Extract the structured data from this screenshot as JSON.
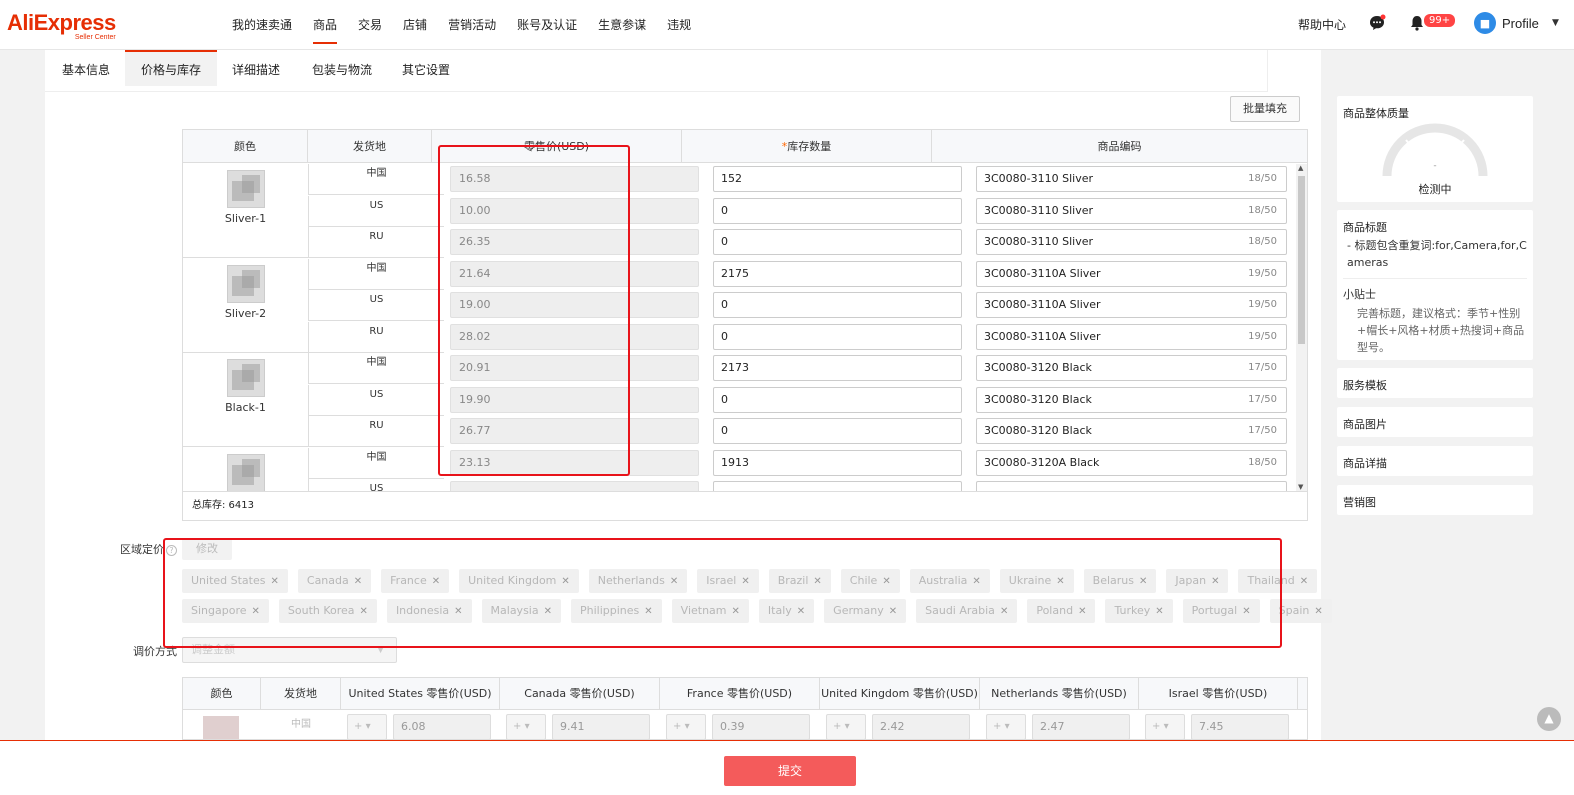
{
  "brand": {
    "name": "AliExpress",
    "sub": "Seller Center"
  },
  "topnav": [
    "我的速卖通",
    "商品",
    "交易",
    "店铺",
    "营销活动",
    "账号及认证",
    "生意参谋",
    "违规"
  ],
  "topnav_active": 1,
  "header": {
    "help": "帮助中心",
    "notify_badge": "99+",
    "profile": "Profile"
  },
  "tabs": [
    "基本信息",
    "价格与库存",
    "详细描述",
    "包装与物流",
    "其它设置"
  ],
  "batch_fill": "批量填充",
  "sku_headers": {
    "color": "颜色",
    "ship_from": "发货地",
    "price": "零售价(USD)",
    "stock": "库存数量",
    "code": "商品编码"
  },
  "sku_groups": [
    {
      "name": "Sliver-1",
      "rows": [
        {
          "wh": "中国",
          "price": "16.58",
          "stock": "152",
          "code": "3C0080-3110 Sliver",
          "count": "18/50"
        },
        {
          "wh": "US",
          "price": "10.00",
          "stock": "0",
          "code": "3C0080-3110 Sliver",
          "count": "18/50"
        },
        {
          "wh": "RU",
          "price": "26.35",
          "stock": "0",
          "code": "3C0080-3110 Sliver",
          "count": "18/50"
        }
      ]
    },
    {
      "name": "Sliver-2",
      "rows": [
        {
          "wh": "中国",
          "price": "21.64",
          "stock": "2175",
          "code": "3C0080-3110A Sliver",
          "count": "19/50"
        },
        {
          "wh": "US",
          "price": "19.00",
          "stock": "0",
          "code": "3C0080-3110A Sliver",
          "count": "19/50"
        },
        {
          "wh": "RU",
          "price": "28.02",
          "stock": "0",
          "code": "3C0080-3110A Sliver",
          "count": "19/50"
        }
      ]
    },
    {
      "name": "Black-1",
      "rows": [
        {
          "wh": "中国",
          "price": "20.91",
          "stock": "2173",
          "code": "3C0080-3120 Black",
          "count": "17/50"
        },
        {
          "wh": "US",
          "price": "19.90",
          "stock": "0",
          "code": "3C0080-3120 Black",
          "count": "17/50"
        },
        {
          "wh": "RU",
          "price": "26.77",
          "stock": "0",
          "code": "3C0080-3120 Black",
          "count": "17/50"
        }
      ]
    },
    {
      "name": "",
      "rows": [
        {
          "wh": "中国",
          "price": "23.13",
          "stock": "1913",
          "code": "3C0080-3120A Black",
          "count": "18/50"
        },
        {
          "wh": "US",
          "price": "",
          "stock": "",
          "code": "",
          "count": ""
        }
      ]
    }
  ],
  "total_stock": "总库存: 6413",
  "region": {
    "label": "区域定价",
    "modify": "修改",
    "countries_row1": [
      "United States",
      "Canada",
      "France",
      "United Kingdom",
      "Netherlands",
      "Israel",
      "Brazil",
      "Chile",
      "Australia",
      "Ukraine",
      "Belarus",
      "Japan",
      "Thailand"
    ],
    "countries_row2": [
      "Singapore",
      "South Korea",
      "Indonesia",
      "Malaysia",
      "Philippines",
      "Vietnam",
      "Italy",
      "Germany",
      "Saudi Arabia",
      "Poland",
      "Turkey",
      "Portugal",
      "Spain"
    ],
    "adjust_label": "调价方式",
    "adjust_value": "调整金额"
  },
  "rp_headers": [
    "颜色",
    "发货地",
    "United States 零售价(USD)",
    "Canada 零售价(USD)",
    "France 零售价(USD)",
    "United Kingdom 零售价(USD)",
    "Netherlands 零售价(USD)",
    "Israel 零售价(USD)"
  ],
  "rp_row": {
    "wh": "中国",
    "op": "+",
    "values": [
      "6.08",
      "9.41",
      "0.39",
      "2.42",
      "2.47",
      "7.45"
    ]
  },
  "sidebar": {
    "quality_title": "商品整体质量",
    "quality_value": "-",
    "quality_status": "检测中",
    "title_label": "商品标题",
    "title_warn": "- 标题包含重复词:for,Camera,for,Cameras",
    "tips_label": "小贴士",
    "tips_text": "完善标题，建议格式：季节+性别+帽长+风格+材质+热搜词+商品型号。",
    "service": "服务模板",
    "images": "商品图片",
    "detail": "商品详描",
    "marketing": "营销图"
  },
  "submit": "提交"
}
